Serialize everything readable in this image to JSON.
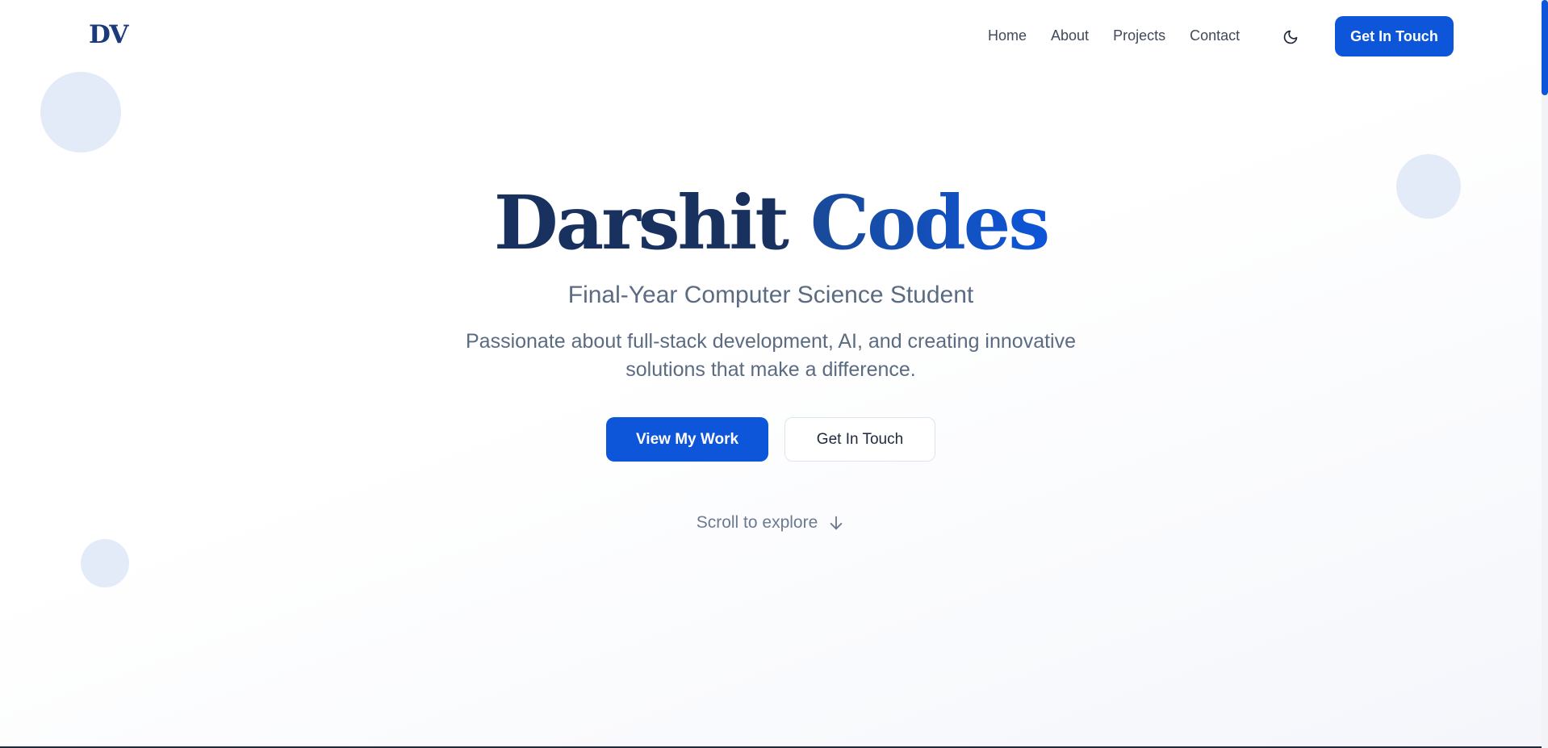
{
  "header": {
    "logo": "DV",
    "nav": [
      "Home",
      "About",
      "Projects",
      "Contact"
    ],
    "theme_icon": "moon-icon",
    "cta_label": "Get In Touch"
  },
  "hero": {
    "title_first": "Darshit",
    "title_second": "Codes",
    "subtitle": "Final-Year Computer Science Student",
    "description": "Passionate about full-stack development, AI, and creating innovative solutions that make a difference.",
    "primary_button": "View My Work",
    "secondary_button": "Get In Touch",
    "scroll_hint": "Scroll to explore",
    "scroll_icon": "arrow-down-icon"
  },
  "colors": {
    "accent": "#0d55d9",
    "title_dark": "#18315f",
    "muted_text": "#5b6b82",
    "circle": "#e3ebf8"
  }
}
